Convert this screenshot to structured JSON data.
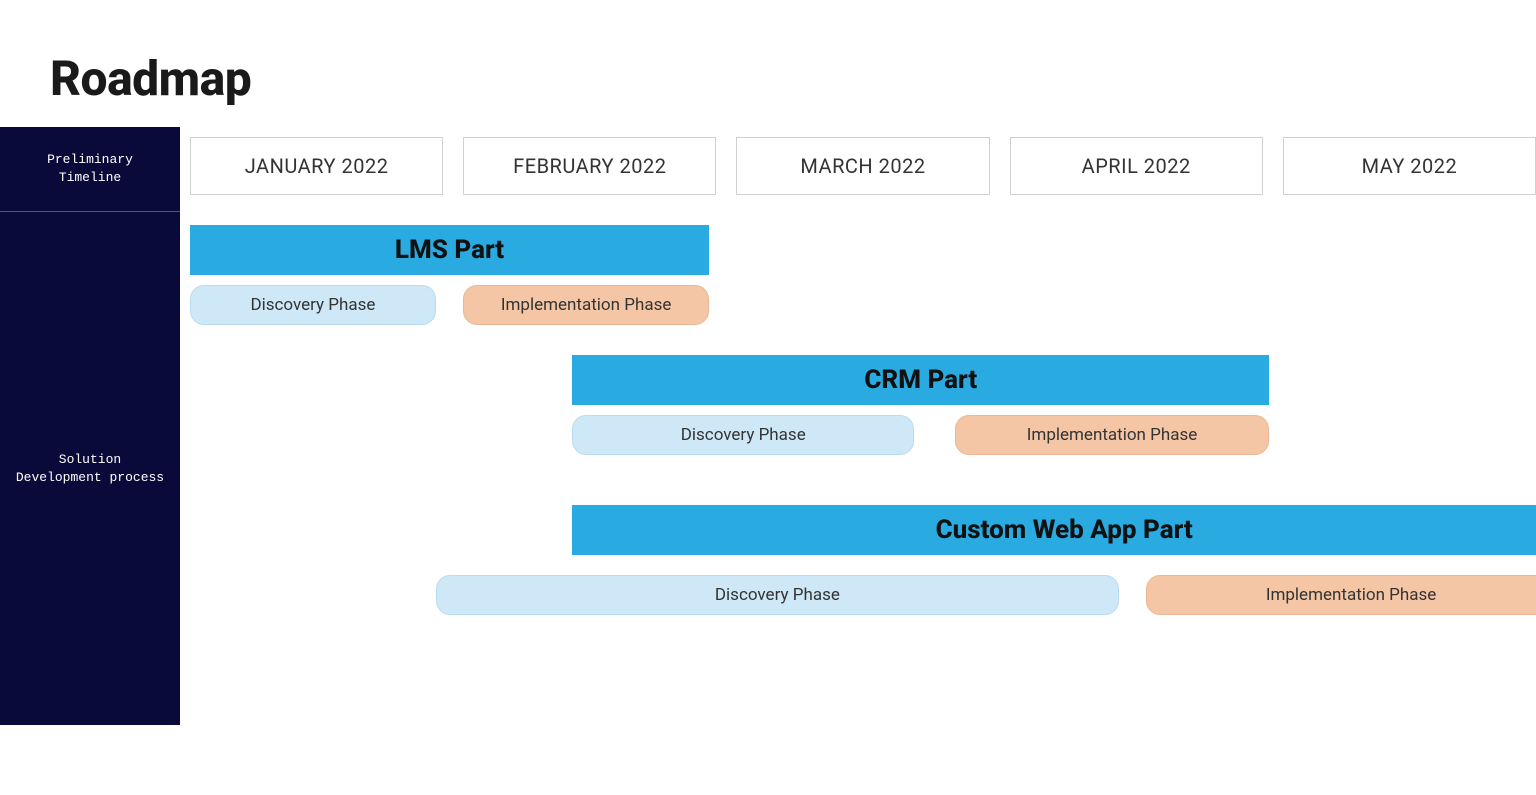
{
  "title": "Roadmap",
  "sidebar": {
    "header_line1": "Preliminary",
    "header_line2": "Timeline",
    "body_line1": "Solution",
    "body_line2": "Development process"
  },
  "chart_data": {
    "type": "gantt",
    "title": "Roadmap",
    "x_axis_label": "Preliminary Timeline",
    "y_axis_label": "Solution Development process",
    "months": [
      "JANUARY 2022",
      "FEBRUARY 2022",
      "MARCH 2022",
      "APRIL 2022",
      "MAY 2022"
    ],
    "timeline_range": [
      "2022-01",
      "2022-05"
    ],
    "tracks": [
      {
        "name": "LMS Part",
        "start_month_index": 0,
        "end_month_index": 1.9,
        "phases": [
          {
            "label": "Discovery Phase",
            "type": "discovery",
            "start_month_index": 0,
            "end_month_index": 0.9
          },
          {
            "label": "Implementation Phase",
            "type": "implementation",
            "start_month_index": 1.0,
            "end_month_index": 1.9
          }
        ]
      },
      {
        "name": "CRM Part",
        "start_month_index": 1.4,
        "end_month_index": 3.95,
        "phases": [
          {
            "label": "Discovery Phase",
            "type": "discovery",
            "start_month_index": 1.4,
            "end_month_index": 2.65
          },
          {
            "label": "Implementation Phase",
            "type": "implementation",
            "start_month_index": 2.8,
            "end_month_index": 3.95
          }
        ]
      },
      {
        "name": "Custom Web App Part",
        "start_month_index": 1.4,
        "end_month_index": 5.0,
        "phases": [
          {
            "label": "Discovery Phase",
            "type": "discovery",
            "start_month_index": 0.9,
            "end_month_index": 3.4
          },
          {
            "label": "Implementation Phase",
            "type": "implementation",
            "start_month_index": 3.5,
            "end_month_index": 5.0
          }
        ]
      }
    ]
  }
}
